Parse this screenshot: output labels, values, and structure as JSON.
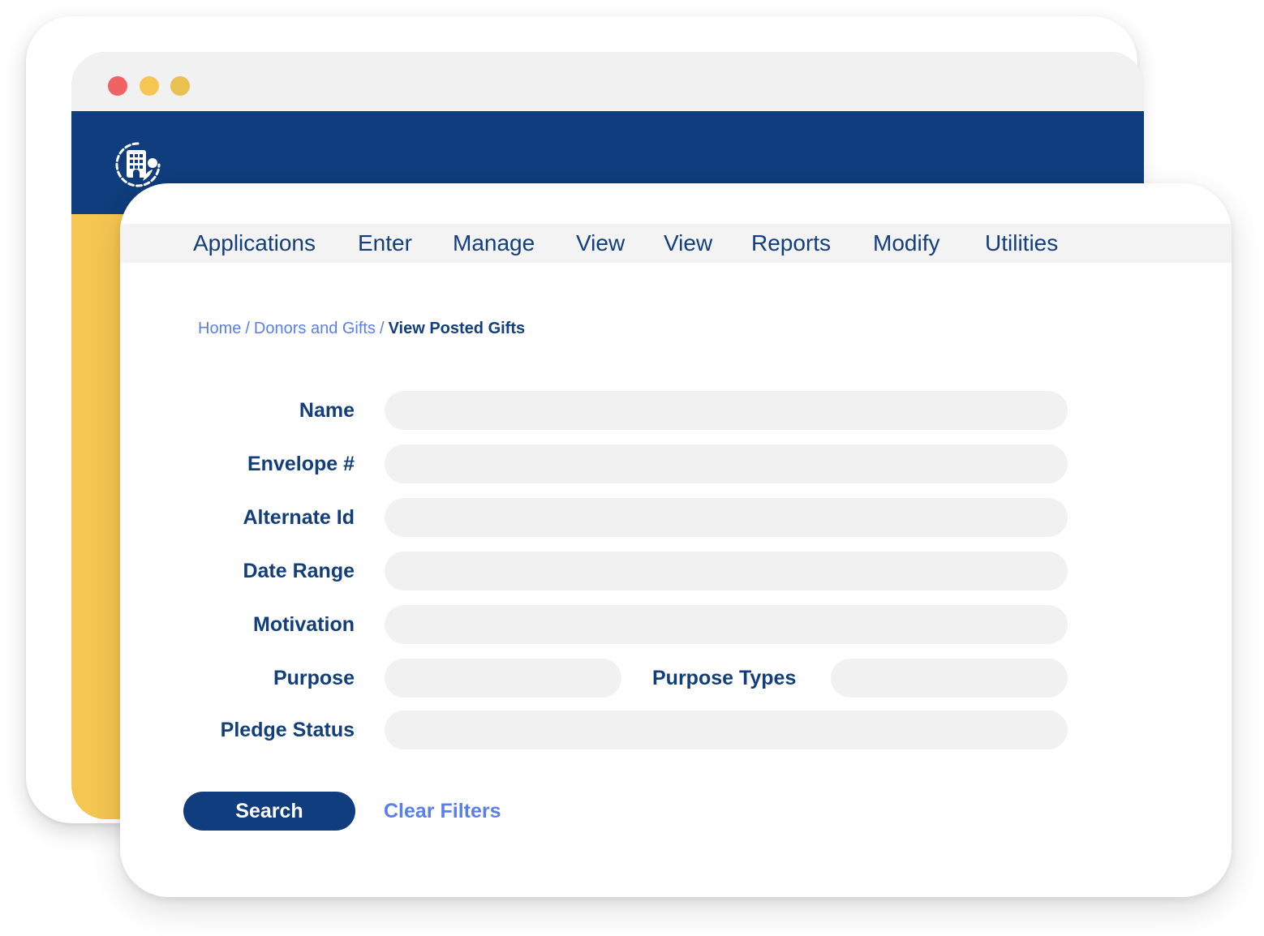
{
  "window": {
    "controls": [
      {
        "name": "close",
        "color": "#f06363"
      },
      {
        "name": "minimize",
        "color": "#f6c652"
      },
      {
        "name": "maximize",
        "color": "#e8c150"
      }
    ],
    "appbar_color": "#0f3d7d",
    "sidebar_color": "#f6c652",
    "logo_icon": "building-people-icon"
  },
  "menu": {
    "items": [
      "Applications",
      "Enter",
      "Manage",
      "View",
      "View",
      "Reports",
      "Modify",
      "Utilities"
    ]
  },
  "breadcrumb": {
    "home": "Home",
    "section": "Donors and Gifts",
    "current": "View Posted Gifts",
    "separator": "/"
  },
  "form": {
    "name_label": "Name",
    "name_value": "",
    "envelope_label": "Envelope #",
    "envelope_value": "",
    "alternate_id_label": "Alternate Id",
    "alternate_id_value": "",
    "date_range_label": "Date Range",
    "date_range_value": "",
    "motivation_label": "Motivation",
    "motivation_value": "",
    "purpose_label": "Purpose",
    "purpose_value": "",
    "purpose_types_label": "Purpose Types",
    "purpose_types_value": "",
    "pledge_status_label": "Pledge Status",
    "pledge_status_value": ""
  },
  "actions": {
    "search_label": "Search",
    "clear_label": "Clear Filters"
  },
  "colors": {
    "primary": "#0f3d7d",
    "link": "#5b7fe8",
    "input_bg": "#f1f1f1"
  }
}
